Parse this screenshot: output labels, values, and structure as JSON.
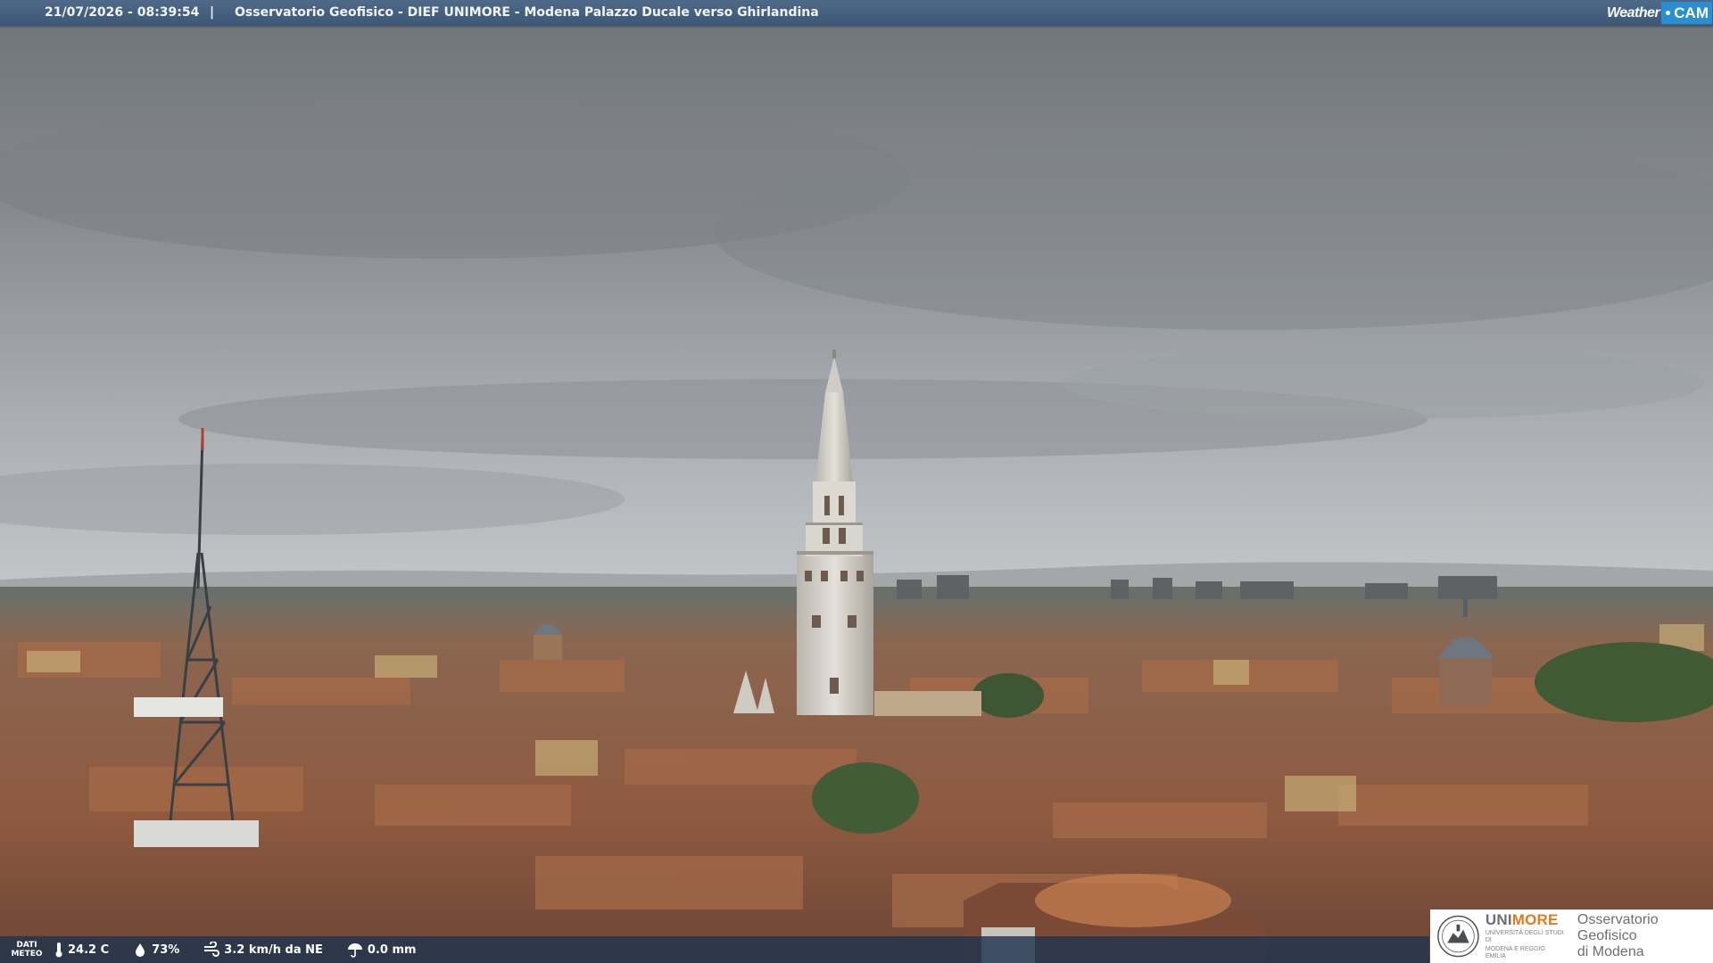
{
  "header": {
    "timestamp": "21/07/2026 - 08:39:54",
    "separator": "|",
    "title": "Osservatorio Geofisico - DIEF UNIMORE - Modena Palazzo Ducale verso Ghirlandina",
    "brand_weather": "Weather",
    "brand_cam": "CAM"
  },
  "meteo": {
    "label_line1": "DATI",
    "label_line2": "METEO",
    "temperature": "24.2 C",
    "humidity": "73%",
    "wind": "3.2 km/h da NE",
    "rain": "0.0 mm"
  },
  "logo": {
    "uni_part1": "UNI",
    "uni_part2": "MORE",
    "uni_sub_line1": "UNIVERSITÀ DEGLI STUDI DI",
    "uni_sub_line2": "MODENA E REGGIO EMILIA",
    "obs_line1": "Osservatorio Geofisico",
    "obs_line2": "di Modena"
  },
  "colors": {
    "header_bar": "#445f7e",
    "cam_badge": "#2a8ed0",
    "unimore_accent": "#e07a1f",
    "sky": "#9a9ea2",
    "roofs": "#8a5a40"
  }
}
